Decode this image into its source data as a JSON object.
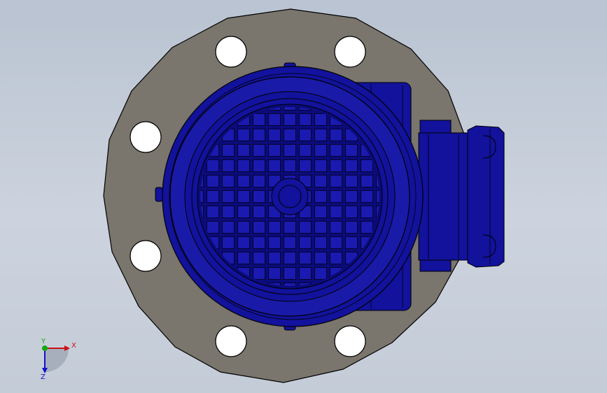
{
  "viewport": {
    "background": "#c6cdd8"
  },
  "model": {
    "flange_color": "#7a756d",
    "motor_color": "#12129c",
    "motor_dark": "#070766",
    "hole_color": "#ffffff",
    "outline_color": "#000000"
  },
  "triad": {
    "x_label": "X",
    "y_label": "Y",
    "z_label": "Z",
    "x_color": "#cc1111",
    "y_color": "#11aa11",
    "z_color": "#1111cc"
  }
}
